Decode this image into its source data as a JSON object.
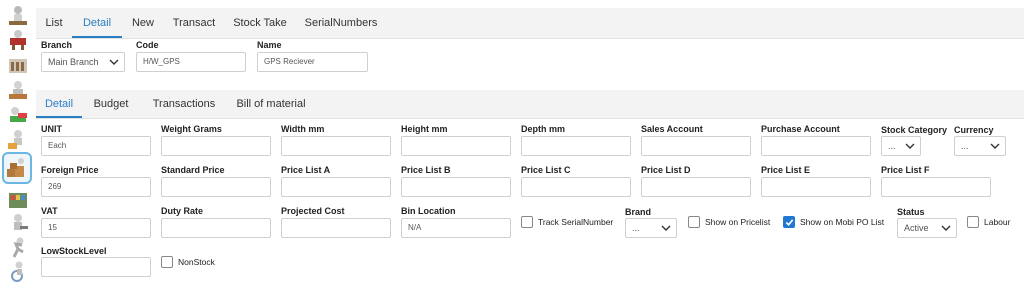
{
  "sidebar": {
    "icons": [
      "person-icon",
      "fighter-icon",
      "warehouse-icon",
      "builder-icon",
      "money-icon",
      "courier-icon",
      "stock-boxes-icon",
      "shelves-icon",
      "wrench-person-icon",
      "runner-icon",
      "wheelchair-icon"
    ],
    "active_index": 6
  },
  "top_tabs": [
    "List",
    "Detail",
    "New",
    "Transact",
    "Stock Take",
    "SerialNumbers"
  ],
  "active_top_tab": "Detail",
  "header": {
    "branch_label": "Branch",
    "branch_value": "Main Branch",
    "code_label": "Code",
    "code_value": "H/W_GPS",
    "name_label": "Name",
    "name_value": "GPS Reciever"
  },
  "sub_tabs": [
    "Detail",
    "Budget",
    "Transactions",
    "Bill of material"
  ],
  "active_sub_tab": "Detail",
  "form": {
    "row1": {
      "unit_label": "UNIT",
      "unit_value": "Each",
      "weight_label": "Weight Grams",
      "width_label": "Width mm",
      "height_label": "Height mm",
      "depth_label": "Depth mm",
      "sales_label": "Sales Account",
      "purchase_label": "Purchase Account",
      "stockcat_label": "Stock Category",
      "stockcat_value": "...",
      "currency_label": "Currency",
      "currency_value": "..."
    },
    "row2": {
      "foreign_label": "Foreign Price",
      "foreign_value": "269",
      "standard_label": "Standard Price",
      "pla_label": "Price List A",
      "plb_label": "Price List B",
      "plc_label": "Price List C",
      "pld_label": "Price List D",
      "ple_label": "Price List E",
      "plf_label": "Price List F"
    },
    "row3": {
      "vat_label": "VAT",
      "vat_value": "15",
      "duty_label": "Duty Rate",
      "projected_label": "Projected Cost",
      "bin_label": "Bin Location",
      "bin_value": "N/A",
      "track_label": "Track SerialNumber",
      "brand_label": "Brand",
      "brand_value": "...",
      "pricelist_label": "Show on Pricelist",
      "mobi_label": "Show on Mobi PO List",
      "status_label": "Status",
      "status_value": "Active",
      "labour_label": "Labour"
    },
    "row4": {
      "lowstock_label": "LowStockLevel",
      "nonstock_label": "NonStock"
    }
  },
  "colors": {
    "accent": "#2a7fc4",
    "checkbox_checked": "#1f78d1"
  }
}
